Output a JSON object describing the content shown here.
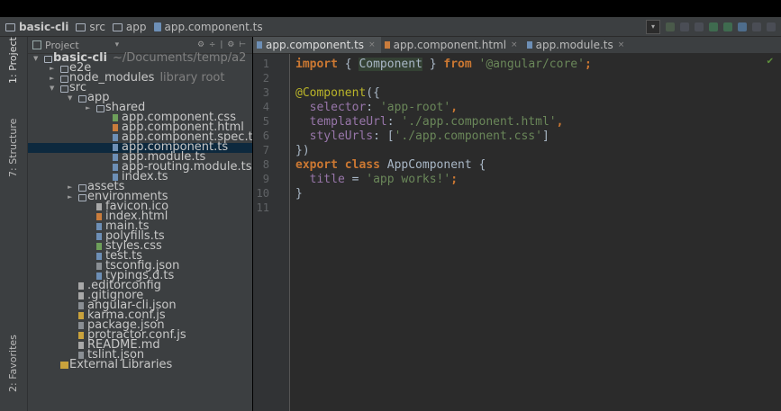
{
  "breadcrumbs": {
    "project": "basic-cli",
    "src": "src",
    "app": "app",
    "file": "app.component.ts"
  },
  "left_strip": {
    "project_tab": "1: Project",
    "structure_tab": "7: Structure",
    "favorites_tab": "2: Favorites"
  },
  "project_panel": {
    "header": "Project"
  },
  "tree": [
    {
      "label": "basic-cli",
      "extra": "~/Documents/temp/a2",
      "type": "folder",
      "arrow": "▼",
      "depth": 0
    },
    {
      "label": "e2e",
      "type": "folder",
      "arrow": "►",
      "depth": 1
    },
    {
      "label": "node_modules",
      "extra": "library root",
      "type": "folder",
      "arrow": "►",
      "depth": 1
    },
    {
      "label": "src",
      "type": "folder",
      "arrow": "▼",
      "depth": 1
    },
    {
      "label": "app",
      "type": "folder",
      "arrow": "▼",
      "depth": 2
    },
    {
      "label": "shared",
      "type": "folder",
      "arrow": "►",
      "depth": 3
    },
    {
      "label": "app.component.css",
      "type": "css",
      "depth": 4
    },
    {
      "label": "app.component.html",
      "type": "html",
      "depth": 4
    },
    {
      "label": "app.component.spec.ts",
      "type": "ts",
      "depth": 4
    },
    {
      "label": "app.component.ts",
      "type": "ts",
      "depth": 4,
      "selected": true
    },
    {
      "label": "app.module.ts",
      "type": "ts",
      "depth": 4
    },
    {
      "label": "app-routing.module.ts",
      "type": "ts",
      "depth": 4
    },
    {
      "label": "index.ts",
      "type": "ts",
      "depth": 4
    },
    {
      "label": "assets",
      "type": "folder",
      "arrow": "►",
      "depth": 2
    },
    {
      "label": "environments",
      "type": "folder",
      "arrow": "►",
      "depth": 2
    },
    {
      "label": "favicon.ico",
      "type": "text",
      "depth": 3
    },
    {
      "label": "index.html",
      "type": "html",
      "depth": 3
    },
    {
      "label": "main.ts",
      "type": "ts",
      "depth": 3
    },
    {
      "label": "polyfills.ts",
      "type": "ts",
      "depth": 3
    },
    {
      "label": "styles.css",
      "type": "css",
      "depth": 3
    },
    {
      "label": "test.ts",
      "type": "ts",
      "depth": 3
    },
    {
      "label": "tsconfig.json",
      "type": "json",
      "depth": 3
    },
    {
      "label": "typings.d.ts",
      "type": "ts",
      "depth": 3
    },
    {
      "label": ".editorconfig",
      "type": "text",
      "depth": 2
    },
    {
      "label": ".gitignore",
      "type": "text",
      "depth": 2
    },
    {
      "label": "angular-cli.json",
      "type": "json",
      "depth": 2
    },
    {
      "label": "karma.conf.js",
      "type": "js",
      "depth": 2
    },
    {
      "label": "package.json",
      "type": "json",
      "depth": 2
    },
    {
      "label": "protractor.conf.js",
      "type": "js",
      "depth": 2
    },
    {
      "label": "README.md",
      "type": "text",
      "depth": 2
    },
    {
      "label": "tslint.json",
      "type": "json",
      "depth": 2
    },
    {
      "label": "External Libraries",
      "type": "lib",
      "depth": 1
    }
  ],
  "editor_tabs": [
    {
      "label": "app.component.ts",
      "type": "ts",
      "active": true
    },
    {
      "label": "app.component.html",
      "type": "html",
      "active": false
    },
    {
      "label": "app.module.ts",
      "type": "ts",
      "active": false
    }
  ],
  "line_numbers": [
    "1",
    "2",
    "3",
    "4",
    "5",
    "6",
    "7",
    "8",
    "9",
    "10",
    "11"
  ],
  "code_lines": [
    [
      {
        "t": "import",
        "c": "kw"
      },
      {
        "t": " { ",
        "c": "ident"
      },
      {
        "t": "Component",
        "c": "compname"
      },
      {
        "t": " } ",
        "c": "ident"
      },
      {
        "t": "from",
        "c": "kw"
      },
      {
        "t": " ",
        "c": "ident"
      },
      {
        "t": "'@angular/core'",
        "c": "str"
      },
      {
        "t": ";",
        "c": "kw"
      }
    ],
    [],
    [
      {
        "t": "@Component",
        "c": "ann"
      },
      {
        "t": "({",
        "c": "ident"
      }
    ],
    [
      {
        "t": "  selector",
        "c": "prop"
      },
      {
        "t": ": ",
        "c": "ident"
      },
      {
        "t": "'app-root'",
        "c": "str"
      },
      {
        "t": ",",
        "c": "kw"
      }
    ],
    [
      {
        "t": "  templateUrl",
        "c": "prop"
      },
      {
        "t": ": ",
        "c": "ident"
      },
      {
        "t": "'./app.component.html'",
        "c": "str"
      },
      {
        "t": ",",
        "c": "kw"
      }
    ],
    [
      {
        "t": "  styleUrls",
        "c": "prop"
      },
      {
        "t": ": [",
        "c": "ident"
      },
      {
        "t": "'./app.component.css'",
        "c": "str"
      },
      {
        "t": "]",
        "c": "ident"
      }
    ],
    [
      {
        "t": "})",
        "c": "ident"
      }
    ],
    [
      {
        "t": "export class ",
        "c": "kw"
      },
      {
        "t": "AppComponent {",
        "c": "ident"
      }
    ],
    [
      {
        "t": "  title",
        "c": "prop"
      },
      {
        "t": " = ",
        "c": "ident"
      },
      {
        "t": "'app works!'",
        "c": "str"
      },
      {
        "t": ";",
        "c": "kw"
      }
    ],
    [
      {
        "t": "}",
        "c": "ident"
      }
    ],
    []
  ],
  "colors": {
    "editor_bg": "#2b2b2b",
    "panel_bg": "#3c3f41",
    "selection": "#0d293e",
    "keyword": "#cc7832",
    "string": "#6a8759",
    "property": "#9876aa",
    "annotation": "#bbb529"
  }
}
